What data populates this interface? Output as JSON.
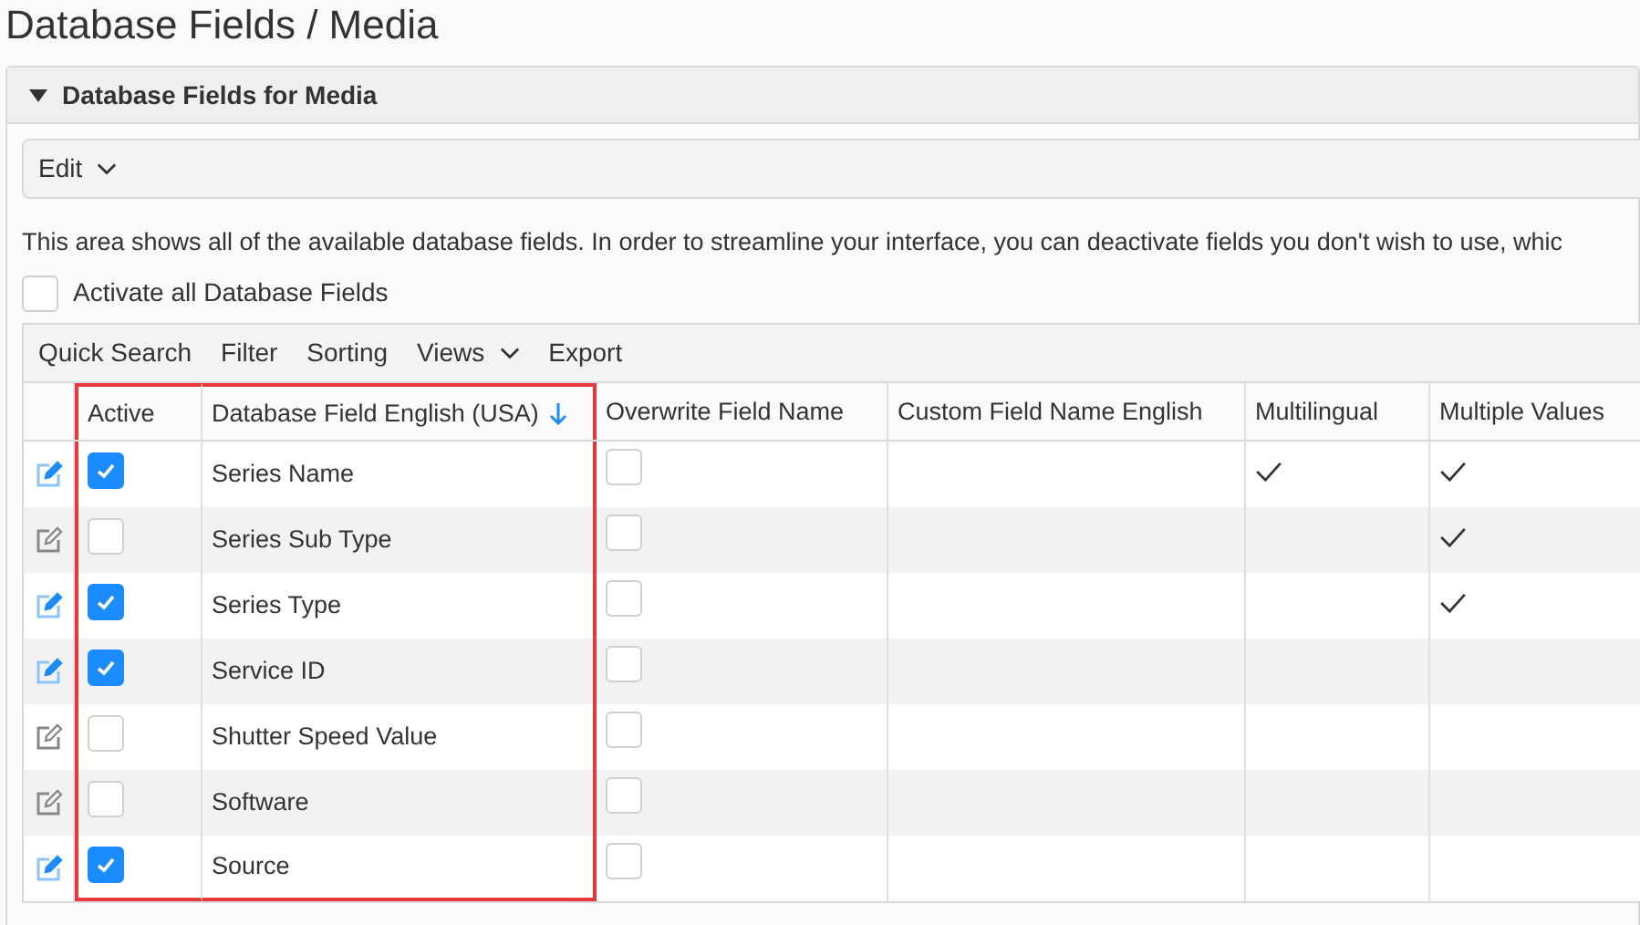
{
  "page_title": "Database Fields / Media",
  "panel": {
    "title": "Database Fields for Media",
    "expanded": true
  },
  "edit_menu": {
    "label": "Edit"
  },
  "description": "This area shows all of the available database fields. In order to streamline your interface, you can deactivate fields you don't wish to use, whic",
  "activate_all": {
    "label": "Activate all Database Fields",
    "checked": false
  },
  "toolbar": [
    {
      "label": "Quick Search",
      "kind": "plain"
    },
    {
      "label": "Filter",
      "kind": "plain"
    },
    {
      "label": "Sorting",
      "kind": "plain"
    },
    {
      "label": "Views",
      "kind": "dropdown"
    },
    {
      "label": "Export",
      "kind": "plain"
    }
  ],
  "table": {
    "columns": [
      {
        "label": "Active",
        "sorted": false,
        "highlighted": true
      },
      {
        "label": "Database Field English (USA)",
        "sorted": true,
        "highlighted": true
      },
      {
        "label": "Overwrite Field Name",
        "sorted": false,
        "highlighted": false
      },
      {
        "label": "Custom Field Name English",
        "sorted": false,
        "highlighted": false
      },
      {
        "label": "Multilingual",
        "sorted": false,
        "highlighted": false
      },
      {
        "label": "Multiple Values",
        "sorted": false,
        "highlighted": false
      }
    ],
    "rows": [
      {
        "active": true,
        "field": "Series Name",
        "overwrite": false,
        "multilingual": true,
        "multiple_values": true
      },
      {
        "active": false,
        "field": "Series Sub Type",
        "overwrite": false,
        "multilingual": false,
        "multiple_values": true
      },
      {
        "active": true,
        "field": "Series Type",
        "overwrite": false,
        "multilingual": false,
        "multiple_values": true
      },
      {
        "active": true,
        "field": "Service ID",
        "overwrite": false,
        "multilingual": false,
        "multiple_values": false
      },
      {
        "active": false,
        "field": "Shutter Speed Value",
        "overwrite": false,
        "multilingual": false,
        "multiple_values": false
      },
      {
        "active": false,
        "field": "Software",
        "overwrite": false,
        "multilingual": false,
        "multiple_values": false
      },
      {
        "active": true,
        "field": "Source",
        "overwrite": false,
        "multilingual": false,
        "multiple_values": false
      }
    ]
  }
}
